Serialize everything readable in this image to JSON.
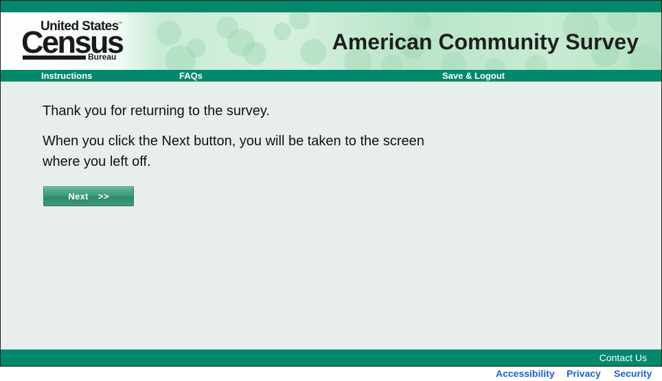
{
  "header": {
    "logo": {
      "line1": "United States",
      "trademark": "™",
      "line2": "Census",
      "line3": "Bureau"
    },
    "title": "American Community Survey"
  },
  "nav": {
    "items": [
      {
        "label": "Instructions"
      },
      {
        "label": "FAQs"
      },
      {
        "label": "Save & Logout"
      }
    ]
  },
  "main": {
    "message1": "Thank you for returning to the survey.",
    "message2": "When you click the Next button, you will be taken to the screen where you left off.",
    "next_button": {
      "label": "Next",
      "arrows": ">>"
    }
  },
  "footer": {
    "contact": "Contact Us",
    "links": [
      {
        "label": "Accessibility"
      },
      {
        "label": "Privacy"
      },
      {
        "label": "Security"
      }
    ]
  },
  "colors": {
    "brand_green": "#00896c",
    "page_background": "#e7eeec",
    "link_blue": "#1a5fcc",
    "button_green": "#3f9b7d"
  }
}
